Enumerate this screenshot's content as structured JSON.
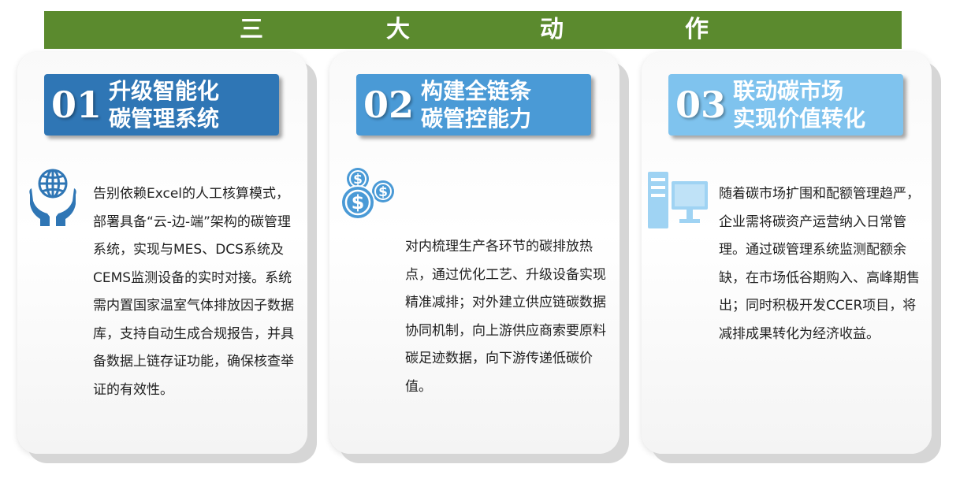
{
  "banner": {
    "chars": [
      "三",
      "大",
      "动",
      "作"
    ]
  },
  "colors": {
    "banner_green": "#5b8a2e",
    "tag1": "#2f76b5",
    "tag2": "#4a9ad6",
    "tag3": "#7fc3ee",
    "icon1": "#2f76b5",
    "icon2": "#4a9ad6",
    "icon3": "#9fd3f3"
  },
  "cards": [
    {
      "number": "01",
      "title": "升级智能化\n碳管理系统",
      "icon": "globe-hands-icon",
      "text": "告别依赖Excel的人工核算模式，部署具备“云-边-端”架构的碳管理系统，实现与MES、DCS系统及CEMS监测设备的实时对接。系统需内置国家温室气体排放因子数据库，支持自动生成合规报告，并具备数据上链存证功能，确保核查举证的有效性。"
    },
    {
      "number": "02",
      "title": "构建全链条\n碳管控能力",
      "icon": "dollar-coins-icon",
      "text": "对内梳理生产各环节的碳排放热点，通过优化工艺、升级设备实现精准减排；对外建立供应链碳数据协同机制，向上游供应商索要原料碳足迹数据，向下游传递低碳价值。"
    },
    {
      "number": "03",
      "title": "联动碳市场\n实现价值转化",
      "icon": "desktop-computer-icon",
      "text": "随着碳市场扩围和配额管理趋严，企业需将碳资产运营纳入日常管理。通过碳管理系统监测配额余缺，在市场低谷期购入、高峰期售出；同时积极开发CCER项目，将减排成果转化为经济收益。"
    }
  ]
}
